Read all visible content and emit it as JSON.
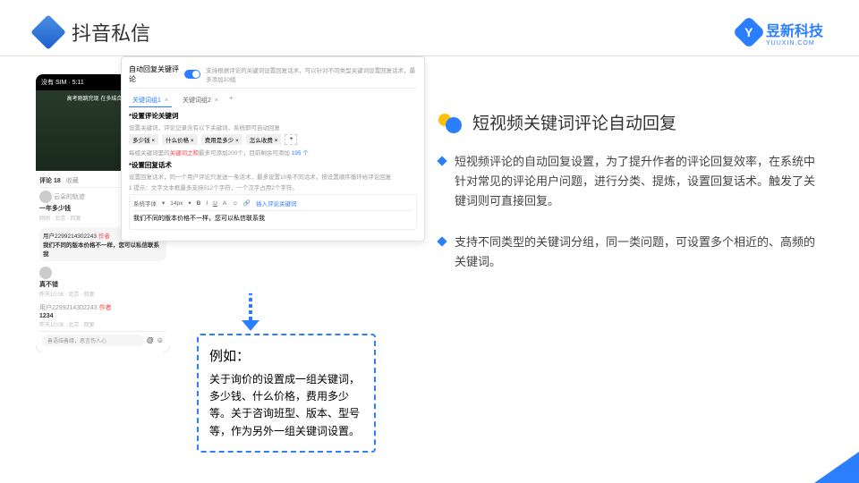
{
  "header": {
    "title": "抖音私信",
    "logo_text": "昱新科技",
    "logo_sub": "YUUXIN.COM",
    "logo_badge": "Y"
  },
  "phone": {
    "status": "没有 SIM · 5:11",
    "video_text": "高考刚跳完现\n在多结合学弟\n学妹倾囊相授",
    "comments_label": "评论 18",
    "favorites_label": "收藏",
    "c1_user": "云朵的轨迹",
    "c1_text": "一年多少钱",
    "c1_meta": "刚刚 · 北京 · 回复",
    "bubble_user": "用户2299214302243",
    "bubble_tag": "作者",
    "bubble_text": "我们不同的版本价格不一样，您可以私信联系我",
    "c2_text": "真不错",
    "c2_meta": "昨天10:08 · 北京 · 回复",
    "c3_user": "用户2299214302243",
    "c3_tag": "作者",
    "c3_text": "1234",
    "c3_meta": "昨天10:08 · 北京 · 回复",
    "input_placeholder": "善语结善缘，恶言伤人心"
  },
  "settings": {
    "toggle_label": "自动回复关键评论",
    "toggle_desc": "支持根据评论的关键词设置回复话术，可以针对不同类型关键词设置回复话术，最多添加10组",
    "tab1": "关键词组1",
    "tab2": "关键词组2",
    "section1_label": "*设置评论关键词",
    "section1_hint": "设置关键词，评论记录含有以下关键词，系统即可自动回复",
    "tags": [
      "多少钱 ×",
      "什么价格 ×",
      "费用是多少 ×",
      "怎么收费 ×"
    ],
    "kw_hint_pre": "每组关键词里的",
    "kw_hint_red": "关键词之和",
    "kw_hint_mid": "最多可添加200个，目前剩余可添加 ",
    "kw_hint_num": "195 个",
    "section2_label": "*设置回复话术",
    "section2_hint": "设置回复话术，同一个用户评论只发送一条话术，最多设置10条不同话术，按设置顺序循环给评论回复",
    "section2_note": "1 提示：文字文本框最多支持512个字符，一个汉字占用2个字符。",
    "font_label": "系统字体",
    "size_label": "14px",
    "insert_label": "插入评论关键词",
    "editor_text": "我们不同的版本价格不一样，您可以私信联系我"
  },
  "example": {
    "title": "例如：",
    "body": "关于询价的设置成一组关键词，多少钱、什么价格，费用多少等。关于咨询班型、版本、型号等，作为另外一组关键词设置。"
  },
  "right": {
    "heading": "短视频关键词评论自动回复",
    "bullet1": "短视频评论的自动回复设置，为了提升作者的评论回复效率，在系统中针对常见的评论用户问题，进行分类、提炼，设置回复话术。触发了关键词则可直接回复。",
    "bullet2": "支持不同类型的关键词分组，同一类问题，可设置多个相近的、高频的关键词。"
  }
}
